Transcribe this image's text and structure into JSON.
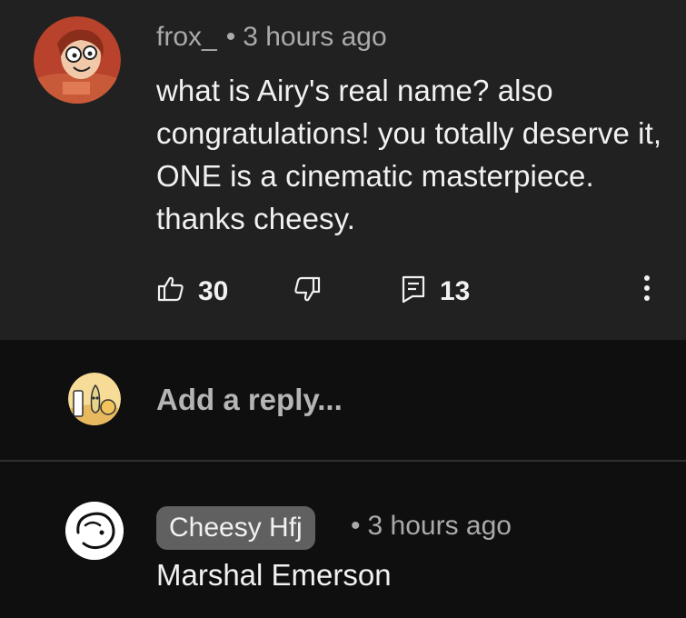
{
  "comment": {
    "author": "frox_",
    "separator": "•",
    "time": "3 hours ago",
    "text": "what is Airy's real name? also congratulations! you totally deserve it, ONE is a cinematic masterpiece. thanks cheesy.",
    "like_count": "30",
    "reply_count": "13"
  },
  "reply_box": {
    "placeholder": "Add a reply..."
  },
  "reply": {
    "author": "Cheesy Hfj",
    "separator": "•",
    "time": "3 hours ago",
    "text": "Marshal Emerson"
  },
  "icons": {
    "like": "thumbs-up-icon",
    "dislike": "thumbs-down-icon",
    "replies": "comment-icon",
    "more": "more-vertical-icon"
  },
  "colors": {
    "card_background": "#212121",
    "page_background": "#0f0f0f",
    "primary_text": "#f1f1f1",
    "secondary_text": "#aaaaaa",
    "author_chip": "#606060"
  }
}
